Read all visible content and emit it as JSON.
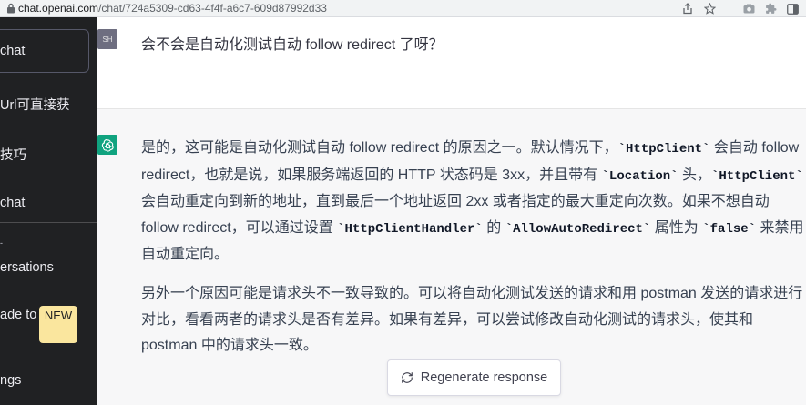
{
  "browser": {
    "url_host": "chat.openai.com",
    "url_path": "/chat/724a5309-cd63-4f4f-a6c7-609d87992d33",
    "icons": [
      "lock-icon",
      "share-icon",
      "star-icon",
      "camera-icon",
      "extensions-icon",
      "sidebar-icon"
    ]
  },
  "sidebar": {
    "new_chat": "chat",
    "items": [
      {
        "label": "Url可直接获"
      },
      {
        "label": "技巧"
      },
      {
        "label": "chat"
      }
    ],
    "clear": {
      "label": "ersations"
    },
    "upgrade": {
      "label": "ade to",
      "badge": "NEW"
    },
    "settings": {
      "label": "ngs"
    }
  },
  "conversation": {
    "user_avatar": "SH",
    "user_message": "会不会是自动化测试自动 follow redirect 了呀？",
    "assistant": {
      "p1_a": "是的，这可能是自动化测试自动 follow redirect 的原因之一。默认情况下，",
      "code_httpclient": "`HttpClient`",
      "p1_b": " 会自动 follow redirect，也就是说，如果服务端返回的 HTTP 状态码是 3xx，并且带有 ",
      "code_location": "`Location`",
      "p1_c": " 头，",
      "code_httpclient2": "`HttpClient`",
      "p1_d": " 会自动重定向到新的地址，直到最后一个地址返回 2xx 或者指定的最大重定向次数。如果不想自动 follow redirect，可以通过设置 ",
      "code_handler": "`HttpClientHandler`",
      "p1_e": " 的 ",
      "code_allow": "`AllowAutoRedirect`",
      "p1_f": " 属性为 ",
      "code_false": "`false`",
      "p1_g": " 来禁用自动重定向。",
      "p2": "另外一个原因可能是请求头不一致导致的。可以将自动化测试发送的请求和用 postman 发送的请求进行对比，看看两者的请求头是否有差异。如果有差异，可以尝试修改自动化测试的请求头，使其和 postman 中的请求头一致。"
    }
  },
  "regenerate": {
    "label": "Regenerate response"
  },
  "colors": {
    "sidebar_bg": "#202123",
    "assistant_bg": "#f7f7f8",
    "brand": "#10a37f",
    "badge": "#fae69e"
  }
}
